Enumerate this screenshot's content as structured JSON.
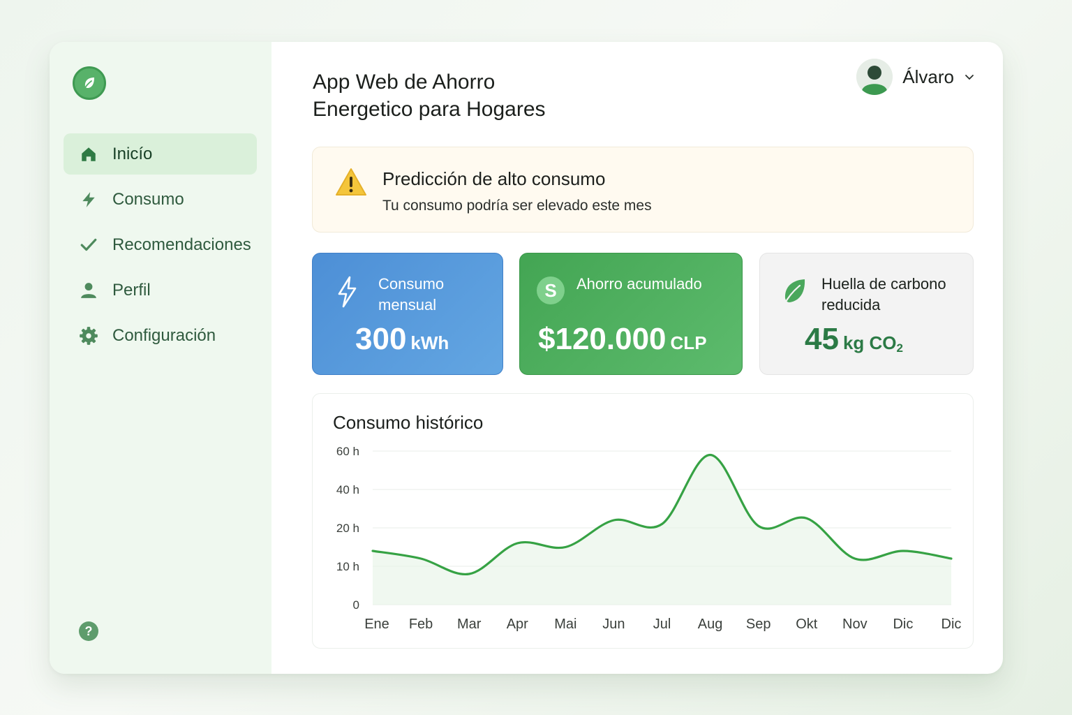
{
  "header": {
    "title_line1": "App Web de Ahorro",
    "title_line2": "Energetico para Hogares",
    "user_name": "Álvaro"
  },
  "sidebar": {
    "logo_icon": "leaf-icon",
    "items": [
      {
        "label": "Inicío",
        "icon": "home-icon",
        "active": true
      },
      {
        "label": "Consumo",
        "icon": "lightning-icon",
        "active": false
      },
      {
        "label": "Recomendaciones",
        "icon": "check-icon",
        "active": false
      },
      {
        "label": "Perfil",
        "icon": "user-icon",
        "active": false
      },
      {
        "label": "Configuración",
        "icon": "gear-icon",
        "active": false
      }
    ],
    "help_icon": "question-icon",
    "help_glyph": "?"
  },
  "alert": {
    "title": "Predicción de alto consumo",
    "text": "Tu consumo podría ser elevado este mes",
    "icon": "warning-icon"
  },
  "cards": {
    "monthly": {
      "label_line1": "Consumo",
      "label_line2": "mensual",
      "value": "300",
      "unit": "kWh",
      "icon": "lightning-icon"
    },
    "savings": {
      "label": "Ahorro acumulado",
      "value": "$120.000",
      "unit": "CLP",
      "icon": "dollar-coin-icon",
      "icon_glyph": "S"
    },
    "carbon": {
      "label_line1": "Huella de carbono",
      "label_line2": "reducida",
      "value": "45",
      "unit": "kg CO",
      "unit_sub": "2",
      "icon": "leaf-icon"
    }
  },
  "colors": {
    "accent_green": "#3f9a52",
    "card_blue": "#4d8fd6",
    "card_green": "#43a553",
    "line": "#36a244"
  },
  "chart_data": {
    "type": "line",
    "title": "Consumo histórico",
    "categories": [
      "Ene",
      "Feb",
      "Mar",
      "Apr",
      "Mai",
      "Jun",
      "Jul",
      "Aug",
      "Sep",
      "Okt",
      "Nov",
      "Dic",
      "Dic"
    ],
    "y_ticks": [
      "0",
      "10 h",
      "20 h",
      "40 h",
      "60 h"
    ],
    "series": [
      {
        "values": [
          14,
          12,
          8,
          16,
          15,
          24,
          22,
          58,
          21,
          25,
          12,
          14,
          12
        ]
      }
    ],
    "grid": true
  }
}
